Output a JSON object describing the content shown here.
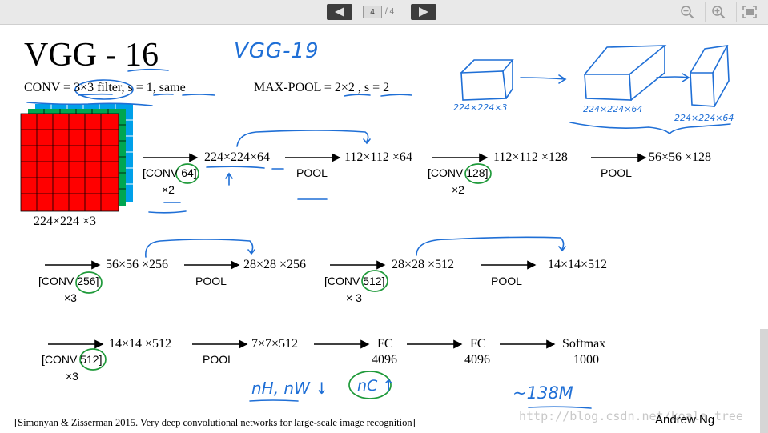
{
  "toolbar": {
    "prev_icon": "triangle-left-icon",
    "next_icon": "triangle-right-icon",
    "page_current": "4",
    "page_total": "/ 4",
    "zoom_out_icon": "zoom-out-icon",
    "zoom_in_icon": "zoom-in-icon",
    "fullscreen_icon": "fullscreen-icon"
  },
  "slide": {
    "title": "VGG - 16",
    "conv_def": "CONV = 3×3 filter, s = 1, same",
    "pool_def": "MAX-POOL = 2×2 , s = 2",
    "input_size": "224×224 ×3",
    "row1": {
      "op1": "[CONV 64]",
      "op1_mult": "×2",
      "n1": "224×224×64",
      "op2": "POOL",
      "n2": "112×112 ×64",
      "op3": "[CONV 128]",
      "op3_mult": "×2",
      "n3": "112×112 ×128",
      "op4": "POOL",
      "n4": "56×56 ×128"
    },
    "row2": {
      "op1": "[CONV 256]",
      "op1_mult": "×3",
      "n1": "56×56 ×256",
      "op2": "POOL",
      "n2": "28×28 ×256",
      "op3": "[CONV 512]",
      "op3_mult": "× 3",
      "n3": "28×28 ×512",
      "op4": "POOL",
      "n4": "14×14×512"
    },
    "row3": {
      "op1": "[CONV 512]",
      "op1_mult": "×3",
      "n1": "14×14 ×512",
      "op2": "POOL",
      "n2": "7×7×512",
      "n3": "FC",
      "n3_sub": "4096",
      "n4": "FC",
      "n4_sub": "4096",
      "n5": "Softmax",
      "n5_sub": "1000"
    },
    "citation": "[Simonyan & Zisserman 2015. Very deep convolutional networks for large-scale image recognition]",
    "author": "Andrew Ng",
    "handwriting": {
      "vgg19": "VGG-19",
      "cube1": "224×224×3",
      "cube2": "224×224×64",
      "cube3": "224×224×64",
      "nh_nw": "nH, nW ↓",
      "nc": "nC ↑",
      "params": "~138M"
    },
    "watermark": "http://blog.csdn.net/koala_tree"
  },
  "colors": {
    "toolbar_bg": "#e9e9e9",
    "toolbar_button": "#3d3d3d",
    "ink_blue": "#1f6fd6",
    "ink_green": "#1f9a3a",
    "grid_red": "#ff0000",
    "grid_green": "#00a651",
    "grid_cyan": "#00a0e9"
  }
}
